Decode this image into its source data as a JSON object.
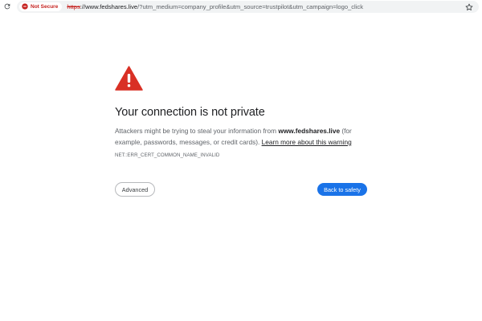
{
  "browser": {
    "security_chip_label": "Not Secure",
    "url_scheme": "https",
    "url_host": "://www.fedshares.live",
    "url_rest": "/?utm_medium=company_profile&utm_source=trustpilot&utm_campaign=logo_click",
    "icons": [
      "reload-icon",
      "warning-circle-icon",
      "star-icon"
    ]
  },
  "interstitial": {
    "title": "Your connection is not private",
    "body_prefix": "Attackers might be trying to steal your information from ",
    "body_domain": "www.fedshares.live",
    "body_suffix": " (for example, passwords, messages, or credit cards). ",
    "learn_more_link": "Learn more about this warning",
    "error_code": "NET::ERR_CERT_COMMON_NAME_INVALID",
    "advanced_button": "Advanced",
    "back_button": "Back to safety",
    "icon": "warning-triangle-icon"
  },
  "colors": {
    "danger": "#c5221f",
    "warning_icon": "#d93025",
    "primary_button": "#1a73e8",
    "text": "#202124",
    "secondary_text": "#5f6368"
  }
}
